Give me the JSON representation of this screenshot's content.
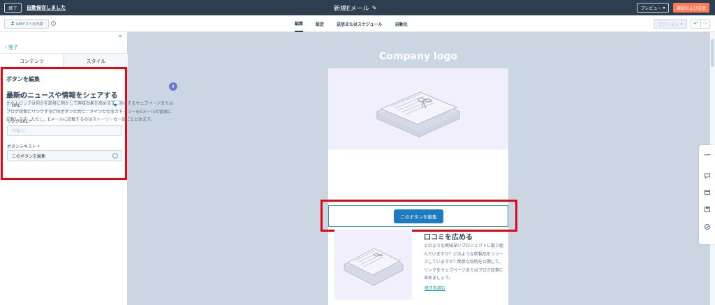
{
  "topbar": {
    "exit_label": "終了",
    "autosave_text": "自動保存しました",
    "title": "新規Eメール",
    "preview_label": "プレビュー",
    "send_label": "確認および送信"
  },
  "subbar": {
    "ab_test_label": "A/Bテストを作成",
    "tabs": [
      {
        "label": "編集"
      },
      {
        "label": "設定"
      },
      {
        "label": "送信またはスケジュール"
      },
      {
        "label": "自動化"
      }
    ],
    "action_label": "アクション"
  },
  "panel": {
    "done_label": "完了",
    "tabs": [
      {
        "label": "コンテンツ"
      },
      {
        "label": "スタイル"
      }
    ],
    "form": {
      "title": "ボタンを編集",
      "link_to_label": "リンク先 *",
      "link_to_value": "URL",
      "link_url_label": "リンクURL *",
      "link_url_placeholder": "http://",
      "button_text_label": "ボタンテキスト *",
      "button_text_value": "このボタンを編集"
    }
  },
  "email": {
    "logo_text": "Company logo",
    "info_badge": "i",
    "section1": {
      "heading": "最新のニュースや情報をシェアする",
      "body": "主なトピックは何かを読者に明かして興味効果を高めます。対応するウェブページまたはブログ記事にリンクするCTAボタンと共に、メインとなるストーリーをEメールの冒頭に記載します。ただし、Eメールに記載するのはストーリーの一部にとどめます。"
    },
    "cta_label": "このボタンを編集",
    "section2": {
      "heading": "口コミを広める",
      "body": "どのような興味深いプロジェクトに取り組んでいますか？どのような新製品をリリースしていますか？簡単な説明を公開して、リンクをウェブページまたはブログ記事に含めましょう。",
      "link": "続きを読む"
    }
  },
  "colors": {
    "topbar": "#2d3e50",
    "accent_orange": "#ff7a59",
    "link_teal": "#0091ae",
    "cta_blue": "#1f7bc1",
    "highlight_red": "#e30613",
    "canvas_bg": "#cbd6e2"
  },
  "icons": [
    "pencil-icon",
    "user-icon",
    "info-icon",
    "chevron-down-icon",
    "undo-icon",
    "redo-icon",
    "double-chevron-left-icon",
    "chevron-left-icon",
    "emoji-icon",
    "grip-icon",
    "comment-icon",
    "calendar-icon",
    "save-icon",
    "check-circle-icon"
  ]
}
